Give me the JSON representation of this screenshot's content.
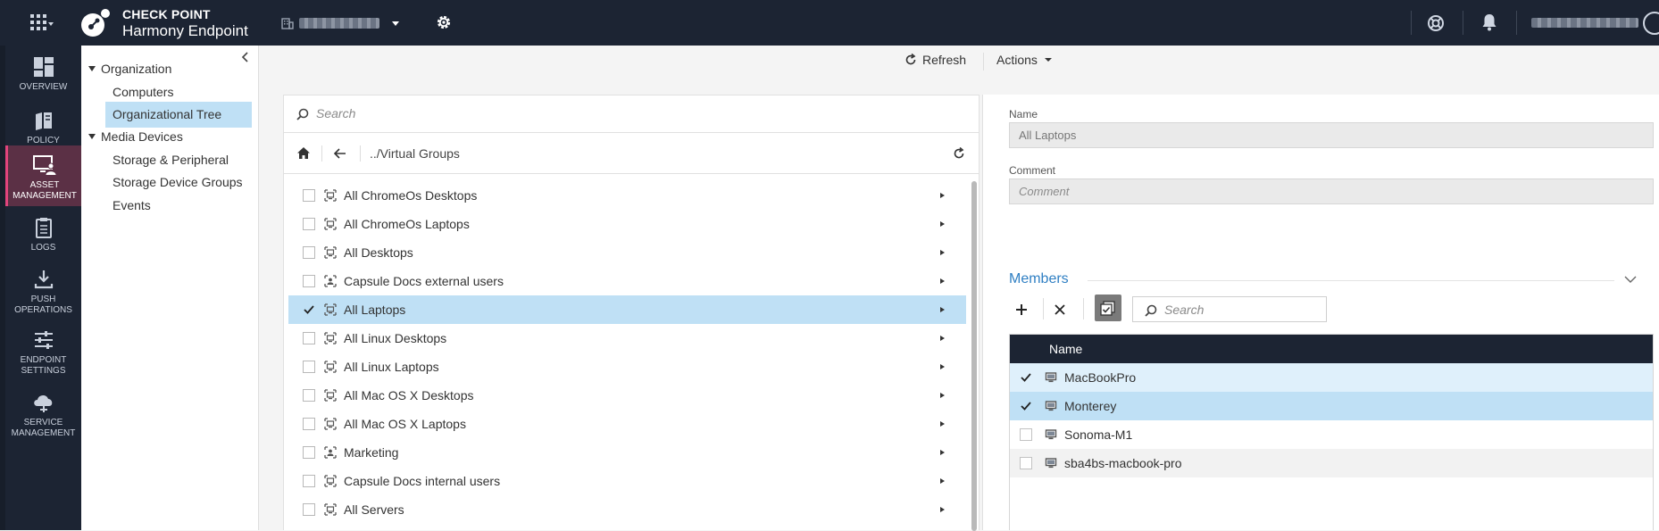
{
  "brand": {
    "line1": "CHECK POINT",
    "line2": "Harmony Endpoint"
  },
  "leftnav": [
    {
      "label_1": "OVERVIEW",
      "label_2": ""
    },
    {
      "label_1": "POLICY",
      "label_2": ""
    },
    {
      "label_1": "ASSET",
      "label_2": "MANAGEMENT"
    },
    {
      "label_1": "LOGS",
      "label_2": ""
    },
    {
      "label_1": "PUSH",
      "label_2": "OPERATIONS"
    },
    {
      "label_1": "ENDPOINT",
      "label_2": "SETTINGS"
    },
    {
      "label_1": "SERVICE",
      "label_2": "MANAGEMENT"
    }
  ],
  "tree": {
    "organization": "Organization",
    "computers": "Computers",
    "organizational_tree": "Organizational Tree",
    "media_devices": "Media Devices",
    "storage_peripheral": "Storage & Peripheral",
    "storage_device_groups": "Storage Device Groups",
    "events": "Events"
  },
  "toolbar": {
    "refresh": "Refresh",
    "actions": "Actions"
  },
  "list": {
    "search_placeholder": "Search",
    "path": "../Virtual Groups",
    "rows": [
      {
        "label": "All ChromeOs Desktops"
      },
      {
        "label": "All ChromeOs Laptops"
      },
      {
        "label": "All Desktops"
      },
      {
        "label": "Capsule Docs external users"
      },
      {
        "label": "All Laptops"
      },
      {
        "label": "All Linux Desktops"
      },
      {
        "label": "All Linux Laptops"
      },
      {
        "label": "All Mac OS X Desktops"
      },
      {
        "label": "All Mac OS X Laptops"
      },
      {
        "label": "Marketing"
      },
      {
        "label": "Capsule Docs internal users"
      },
      {
        "label": "All Servers"
      }
    ]
  },
  "detail": {
    "name_label": "Name",
    "name_value": "All Laptops",
    "comment_label": "Comment",
    "comment_placeholder": "Comment",
    "members_title": "Members",
    "members_search_placeholder": "Search",
    "table_header": "Name",
    "members": [
      {
        "name": "MacBookPro"
      },
      {
        "name": "Monterey"
      },
      {
        "name": "Sonoma-M1"
      },
      {
        "name": "sba4bs-macbook-pro"
      }
    ]
  },
  "colors": {
    "topbar": "#1c2433",
    "accent": "#e0447c",
    "selection": "#bfe0f5",
    "link": "#2f7fc3"
  }
}
